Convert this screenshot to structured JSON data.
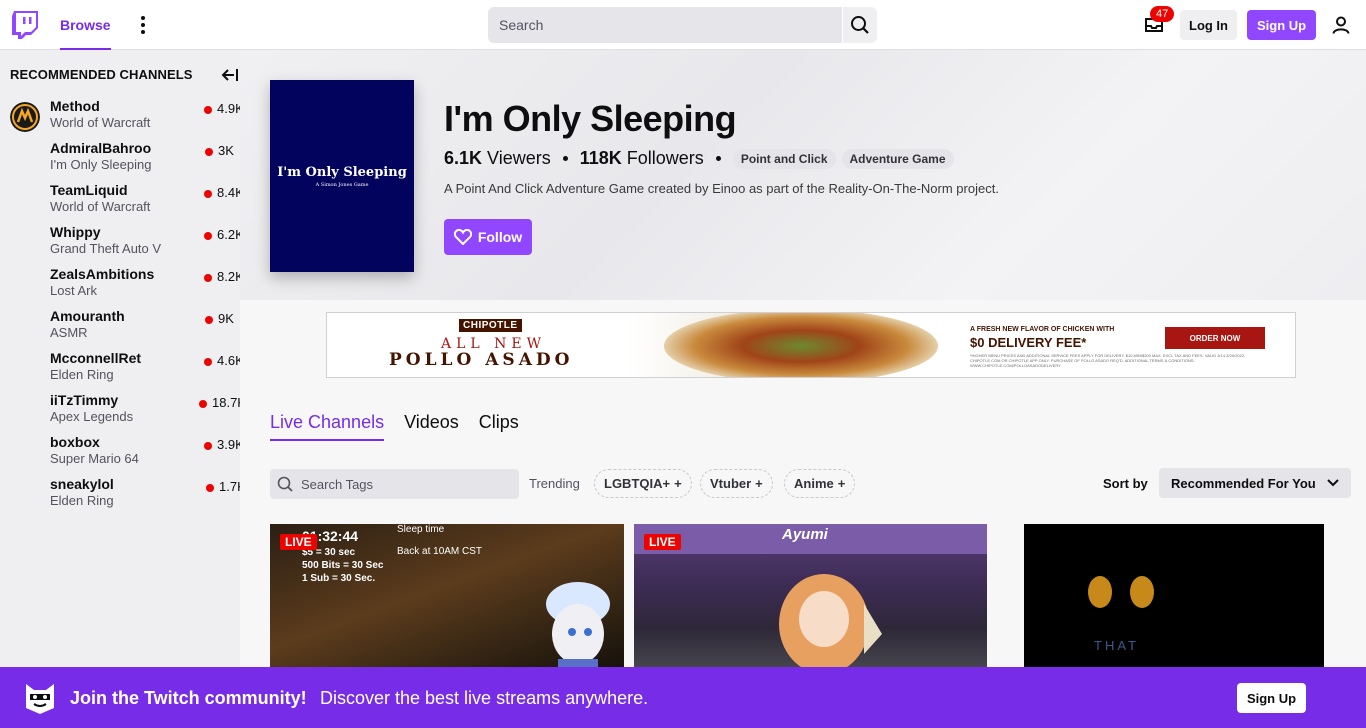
{
  "nav": {
    "browse_label": "Browse",
    "search_placeholder": "Search",
    "inbox_count": "47",
    "login_label": "Log In",
    "signup_label": "Sign Up"
  },
  "sidebar": {
    "heading": "RECOMMENDED CHANNELS",
    "channels": [
      {
        "name": "Method",
        "game": "World of Warcraft",
        "viewers": "4.9K"
      },
      {
        "name": "AdmiralBahroo",
        "game": "I'm Only Sleeping",
        "viewers": "3K"
      },
      {
        "name": "TeamLiquid",
        "game": "World of Warcraft",
        "viewers": "8.4K"
      },
      {
        "name": "Whippy",
        "game": "Grand Theft Auto V",
        "viewers": "6.2K"
      },
      {
        "name": "ZealsAmbitions",
        "game": "Lost Ark",
        "viewers": "8.2K"
      },
      {
        "name": "Amouranth",
        "game": "ASMR",
        "viewers": "9K"
      },
      {
        "name": "McconnellRet",
        "game": "Elden Ring",
        "viewers": "4.6K"
      },
      {
        "name": "iiTzTimmy",
        "game": "Apex Legends",
        "viewers": "18.7K"
      },
      {
        "name": "boxbox",
        "game": "Super Mario 64",
        "viewers": "3.9K"
      },
      {
        "name": "sneakylol",
        "game": "Elden Ring",
        "viewers": "1.7K"
      }
    ]
  },
  "game": {
    "title": "I'm Only Sleeping",
    "boxart_title": "I'm Only Sleeping",
    "boxart_subtitle": "A Simon Jones Game",
    "viewers_value": "6.1K",
    "viewers_label": "Viewers",
    "followers_value": "118K",
    "followers_label": "Followers",
    "tags": [
      "Point and Click",
      "Adventure Game"
    ],
    "description": "A Point And Click Adventure Game created by Einoo as part of the Reality-On-The-Norm project.",
    "follow_label": "Follow"
  },
  "ad": {
    "brand": "CHIPOTLE",
    "line1": "ALL NEW",
    "line2": "POLLO ASADO",
    "right_small": "A FRESH NEW FLAVOR OF CHICKEN WITH",
    "right_big": "$0 DELIVERY FEE*",
    "fine_print": "*HIGHER MENU PRICES AND ADDITIONAL SERVICE FEES APPLY FOR DELIVERY. $10 MIN/$200 MAX. EXCL TAX AND FEES. VALID 3/14-3/20/2022. CHIPOTLE.COM OR CHIPOTLE APP ONLY. PURCHASE OF POLLO ASADO REQ'D. ADDITIONAL TERMS & CONDITIONS: WWW.CHIPOTLE.COM/POLLOASADODELIVERY",
    "cta": "ORDER NOW"
  },
  "tabs": [
    {
      "label": "Live Channels",
      "active": true
    },
    {
      "label": "Videos",
      "active": false
    },
    {
      "label": "Clips",
      "active": false
    }
  ],
  "filters": {
    "tag_search_placeholder": "Search Tags",
    "trending_label": "Trending",
    "chips": [
      "LGBTQIA+",
      "Vtuber",
      "Anime"
    ],
    "sort_label": "Sort by",
    "sort_value": "Recommended For You"
  },
  "streams": [
    {
      "live": "LIVE",
      "overlay": [
        "01:32:44",
        "$5 = 30 sec",
        "500 Bits = 30 Sec",
        "1 Sub = 30 Sec.",
        "Sleep time",
        "Back at 10AM CST"
      ]
    },
    {
      "live": "LIVE",
      "overlay": [
        "Ayumi"
      ]
    },
    {
      "overlay": [
        "THAT"
      ]
    }
  ],
  "footer": {
    "title": "Join the Twitch community!",
    "subtitle": "Discover the best live streams anywhere.",
    "signup_label": "Sign Up"
  },
  "colors": {
    "accent": "#9147ff",
    "accent_dark": "#772ce8",
    "live_red": "#eb0400"
  }
}
